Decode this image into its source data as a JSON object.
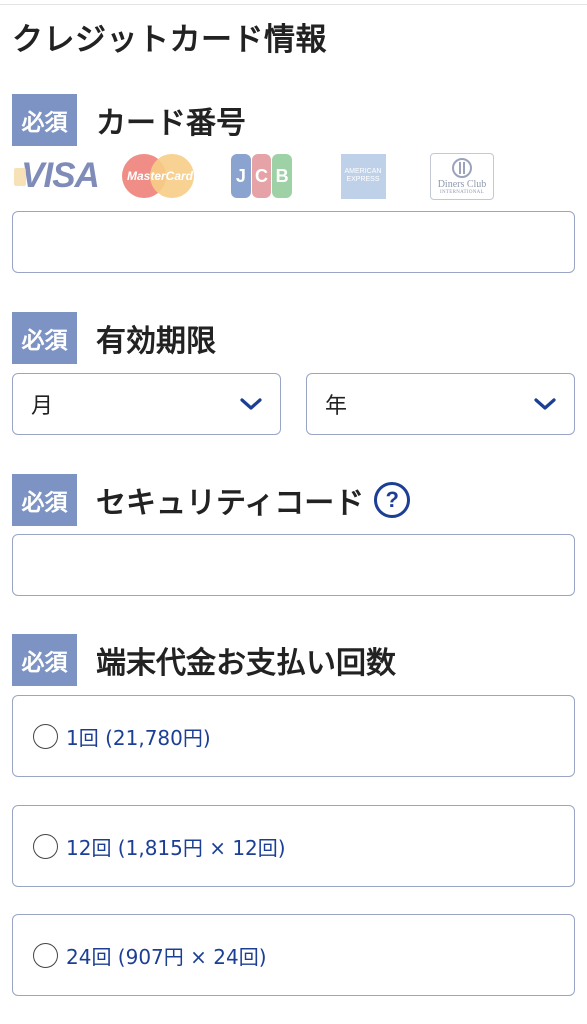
{
  "page": {
    "title": "クレジットカード情報"
  },
  "card_number": {
    "badge": "必須",
    "label": "カード番号",
    "value": "",
    "brands": [
      {
        "name": "VISA",
        "text": "VISA"
      },
      {
        "name": "MasterCard",
        "text": "MasterCard"
      },
      {
        "name": "JCB",
        "letters": [
          "J",
          "C",
          "B"
        ]
      },
      {
        "name": "American Express",
        "lines": [
          "AMERICAN",
          "EXPRESS"
        ]
      },
      {
        "name": "Diners Club",
        "text": "Diners Club",
        "sub": "INTERNATIONAL"
      }
    ]
  },
  "expiry": {
    "badge": "必須",
    "label": "有効期限",
    "month_value": "月",
    "year_value": "年"
  },
  "security_code": {
    "badge": "必須",
    "label": "セキュリティコード",
    "help_glyph": "?",
    "value": ""
  },
  "installments": {
    "badge": "必須",
    "label": "端末代金お支払い回数",
    "options": [
      {
        "label": "1回 (21,780円)",
        "selected": false
      },
      {
        "label": "12回 (1,815円 × 12回)",
        "selected": false
      },
      {
        "label": "24回 (907円 × 24回)",
        "selected": false
      }
    ]
  },
  "colors": {
    "badge_bg": "#7d93c4",
    "accent": "#1c3f95",
    "field_border": "#9aa5c6"
  },
  "icons": {
    "select_chevron": "chevron-down-icon",
    "help": "question-circle-icon"
  }
}
